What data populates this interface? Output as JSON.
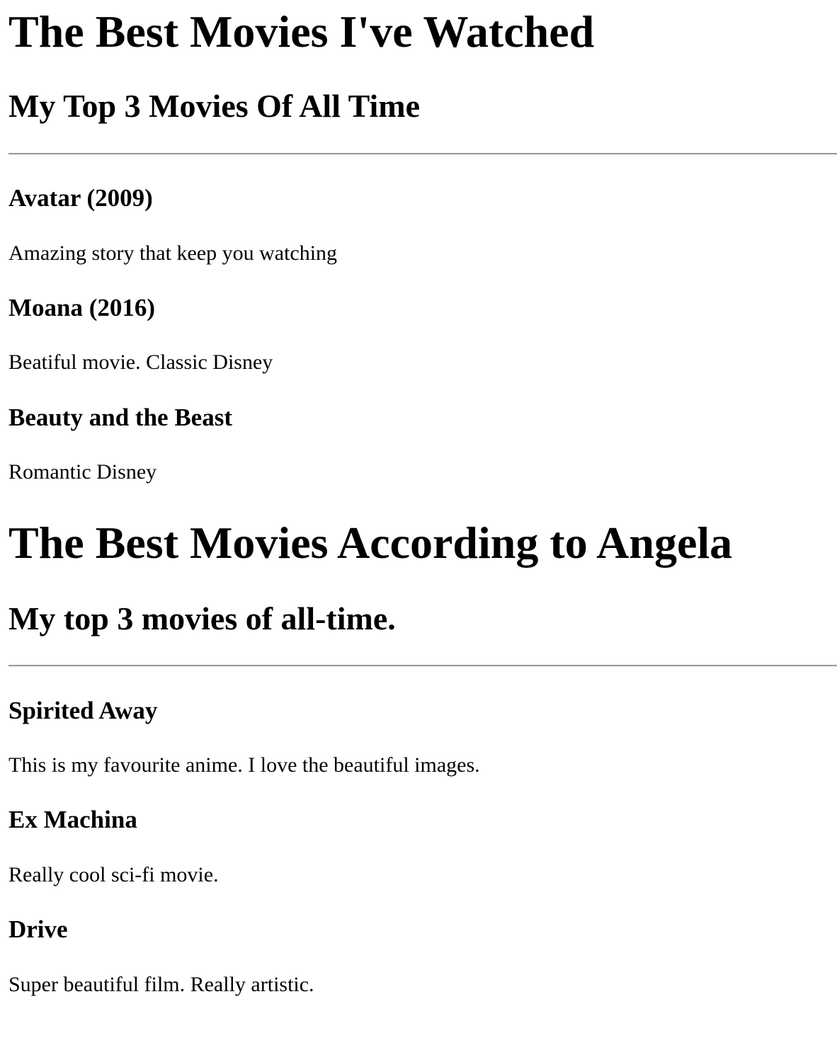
{
  "section_1": {
    "title": "The Best Movies I've Watched",
    "subtitle": "My Top 3 Movies Of All Time",
    "movies": [
      {
        "name": "Avatar (2009)",
        "description": "Amazing story that keep you watching"
      },
      {
        "name": "Moana (2016)",
        "description": "Beatiful movie. Classic Disney"
      },
      {
        "name": "Beauty and the Beast",
        "description": "Romantic Disney"
      }
    ]
  },
  "section_2": {
    "title": "The Best Movies According to Angela",
    "subtitle": "My top 3 movies of all-time.",
    "movies": [
      {
        "name": "Spirited Away",
        "description": "This is my favourite anime. I love the beautiful images."
      },
      {
        "name": "Ex Machina",
        "description": "Really cool sci-fi movie."
      },
      {
        "name": "Drive",
        "description": "Super beautiful film. Really artistic."
      }
    ]
  }
}
